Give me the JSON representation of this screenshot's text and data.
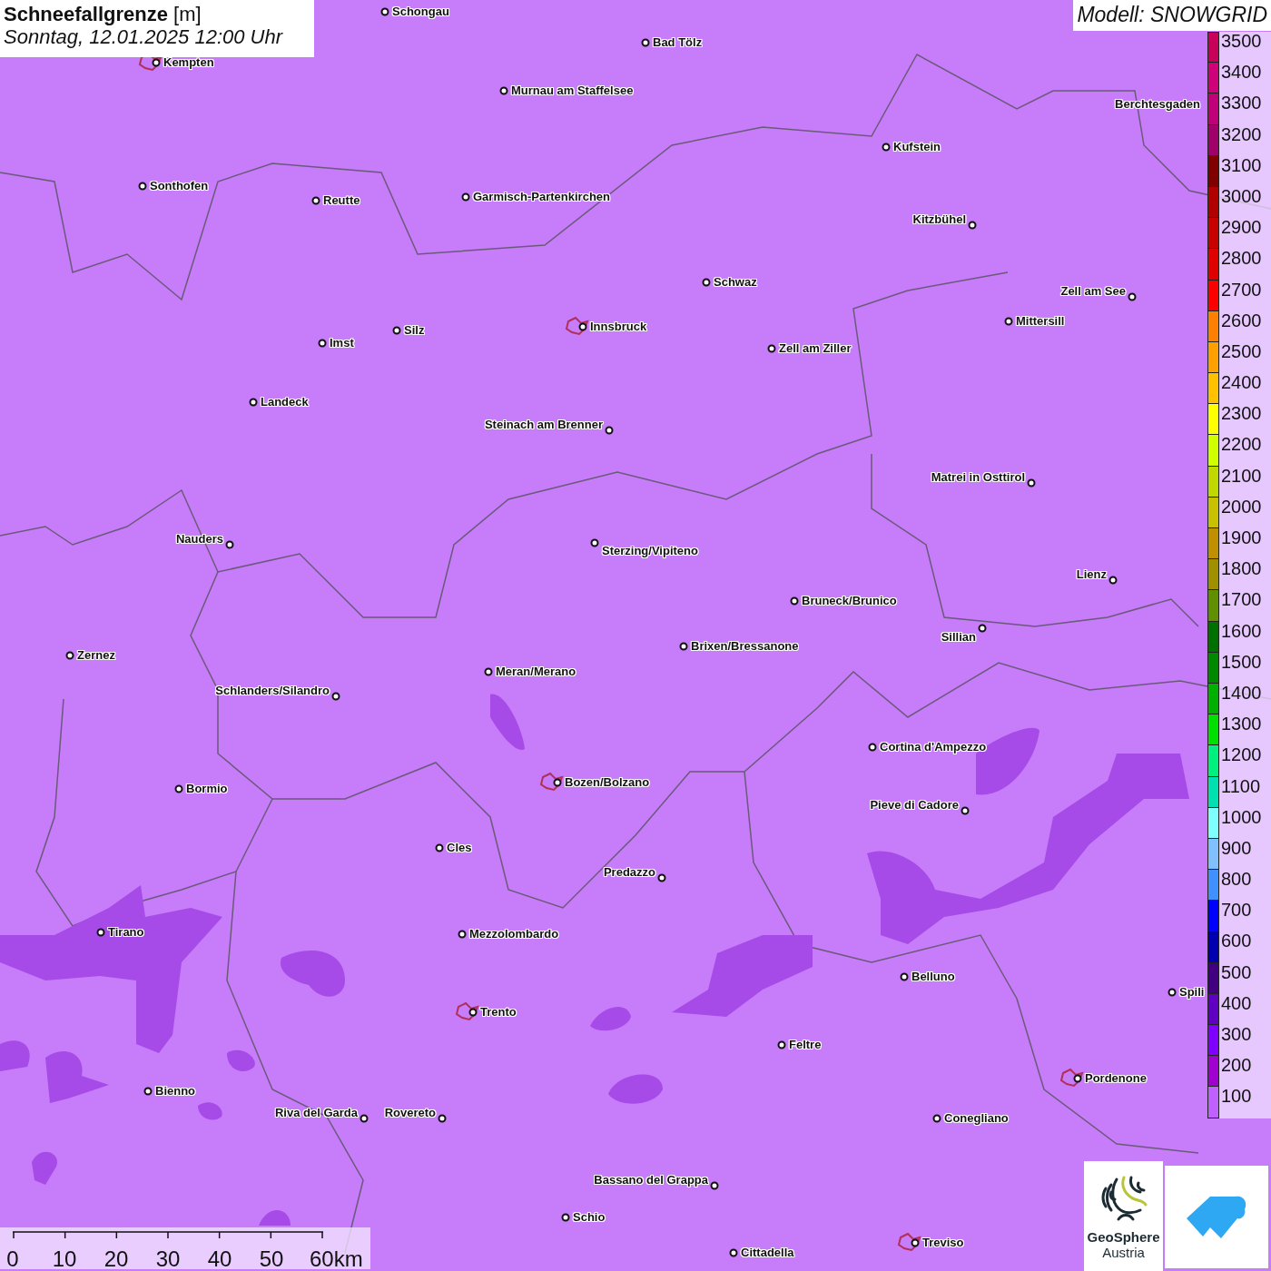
{
  "title": {
    "name": "Schneefallgrenze",
    "unit": "[m]",
    "date": "Sonntag, 12.01.2025 12:00 Uhr"
  },
  "model": "Modell: SNOWGRID",
  "legend": [
    {
      "label": "3500",
      "color": "#c8005a"
    },
    {
      "label": "3400",
      "color": "#d0007a"
    },
    {
      "label": "3300",
      "color": "#c00078"
    },
    {
      "label": "3200",
      "color": "#a0006a"
    },
    {
      "label": "3100",
      "color": "#800000"
    },
    {
      "label": "3000",
      "color": "#b00000"
    },
    {
      "label": "2900",
      "color": "#c80000"
    },
    {
      "label": "2800",
      "color": "#e00000"
    },
    {
      "label": "2700",
      "color": "#ff0000"
    },
    {
      "label": "2600",
      "color": "#ff8000"
    },
    {
      "label": "2500",
      "color": "#ffa000"
    },
    {
      "label": "2400",
      "color": "#ffc000"
    },
    {
      "label": "2300",
      "color": "#ffff00"
    },
    {
      "label": "2200",
      "color": "#d0ff00"
    },
    {
      "label": "2100",
      "color": "#c0d800"
    },
    {
      "label": "2000",
      "color": "#c8c000"
    },
    {
      "label": "1900",
      "color": "#c09000"
    },
    {
      "label": "1800",
      "color": "#a09000"
    },
    {
      "label": "1700",
      "color": "#609000"
    },
    {
      "label": "1600",
      "color": "#007000"
    },
    {
      "label": "1500",
      "color": "#008800"
    },
    {
      "label": "1400",
      "color": "#00b000"
    },
    {
      "label": "1300",
      "color": "#00e000"
    },
    {
      "label": "1200",
      "color": "#00f080"
    },
    {
      "label": "1100",
      "color": "#00e0b0"
    },
    {
      "label": "1000",
      "color": "#80ffff"
    },
    {
      "label": "900",
      "color": "#80c0ff"
    },
    {
      "label": "800",
      "color": "#4090ff"
    },
    {
      "label": "700",
      "color": "#0000ff"
    },
    {
      "label": "600",
      "color": "#0000b0"
    },
    {
      "label": "500",
      "color": "#400080"
    },
    {
      "label": "400",
      "color": "#6000c0"
    },
    {
      "label": "300",
      "color": "#8000ff"
    },
    {
      "label": "200",
      "color": "#a000d0"
    },
    {
      "label": "100",
      "color": "#c060ff"
    }
  ],
  "cities": [
    {
      "name": "Schongau",
      "marker": true,
      "outlined": false
    },
    {
      "name": "Kempten",
      "marker": true,
      "outlined": true
    },
    {
      "name": "Bad Tölz",
      "marker": true,
      "outlined": false
    },
    {
      "name": "Murnau am Staffelsee",
      "marker": true,
      "outlined": false
    },
    {
      "name": "Kufstein",
      "marker": true,
      "outlined": false
    },
    {
      "name": "Berchtesgaden",
      "marker": false,
      "outlined": false
    },
    {
      "name": "Sonthofen",
      "marker": true,
      "outlined": false
    },
    {
      "name": "Reutte",
      "marker": true,
      "outlined": false
    },
    {
      "name": "Garmisch-Partenkirchen",
      "marker": true,
      "outlined": false
    },
    {
      "name": "Kitzbühel",
      "marker": true,
      "outlined": false
    },
    {
      "name": "Schwaz",
      "marker": true,
      "outlined": false
    },
    {
      "name": "Zell am See",
      "marker": true,
      "outlined": false
    },
    {
      "name": "Mittersill",
      "marker": true,
      "outlined": false
    },
    {
      "name": "Innsbruck",
      "marker": true,
      "outlined": true
    },
    {
      "name": "Silz",
      "marker": true,
      "outlined": false
    },
    {
      "name": "Imst",
      "marker": true,
      "outlined": false
    },
    {
      "name": "Zell am Ziller",
      "marker": true,
      "outlined": false
    },
    {
      "name": "Landeck",
      "marker": true,
      "outlined": false
    },
    {
      "name": "Steinach am Brenner",
      "marker": true,
      "outlined": false
    },
    {
      "name": "Matrei in Osttirol",
      "marker": true,
      "outlined": false
    },
    {
      "name": "Nauders",
      "marker": true,
      "outlined": false
    },
    {
      "name": "Sterzing/Vipiteno",
      "marker": true,
      "outlined": false
    },
    {
      "name": "Lienz",
      "marker": true,
      "outlined": false
    },
    {
      "name": "Bruneck/Brunico",
      "marker": true,
      "outlined": false
    },
    {
      "name": "Sillian",
      "marker": true,
      "outlined": false
    },
    {
      "name": "Zernez",
      "marker": true,
      "outlined": false
    },
    {
      "name": "Brixen/Bressanone",
      "marker": true,
      "outlined": false
    },
    {
      "name": "Meran/Merano",
      "marker": true,
      "outlined": false
    },
    {
      "name": "Schlanders/Silandro",
      "marker": true,
      "outlined": false
    },
    {
      "name": "Cortina d'Ampezzo",
      "marker": true,
      "outlined": false
    },
    {
      "name": "Bozen/Bolzano",
      "marker": true,
      "outlined": true
    },
    {
      "name": "Pieve di Cadore",
      "marker": true,
      "outlined": false
    },
    {
      "name": "Bormio",
      "marker": true,
      "outlined": false
    },
    {
      "name": "Cles",
      "marker": true,
      "outlined": false
    },
    {
      "name": "Predazzo",
      "marker": true,
      "outlined": false
    },
    {
      "name": "Tirano",
      "marker": true,
      "outlined": false
    },
    {
      "name": "Mezzolombardo",
      "marker": true,
      "outlined": false
    },
    {
      "name": "Belluno",
      "marker": true,
      "outlined": false
    },
    {
      "name": "Spili",
      "marker": true,
      "outlined": false
    },
    {
      "name": "Trento",
      "marker": true,
      "outlined": true
    },
    {
      "name": "Feltre",
      "marker": true,
      "outlined": false
    },
    {
      "name": "Pordenone",
      "marker": true,
      "outlined": true
    },
    {
      "name": "Bienno",
      "marker": true,
      "outlined": false
    },
    {
      "name": "Riva del Garda",
      "marker": true,
      "outlined": false
    },
    {
      "name": "Rovereto",
      "marker": true,
      "outlined": false
    },
    {
      "name": "Conegliano",
      "marker": true,
      "outlined": false
    },
    {
      "name": "Bassano del Grappa",
      "marker": true,
      "outlined": false
    },
    {
      "name": "Schio",
      "marker": true,
      "outlined": false
    },
    {
      "name": "Cittadella",
      "marker": true,
      "outlined": false
    },
    {
      "name": "Treviso",
      "marker": true,
      "outlined": true
    }
  ],
  "scale": {
    "ticks": [
      "0",
      "10",
      "20",
      "30",
      "40",
      "50",
      "60km"
    ]
  },
  "logo": {
    "name": "GeoSphere",
    "subtitle": "Austria"
  }
}
